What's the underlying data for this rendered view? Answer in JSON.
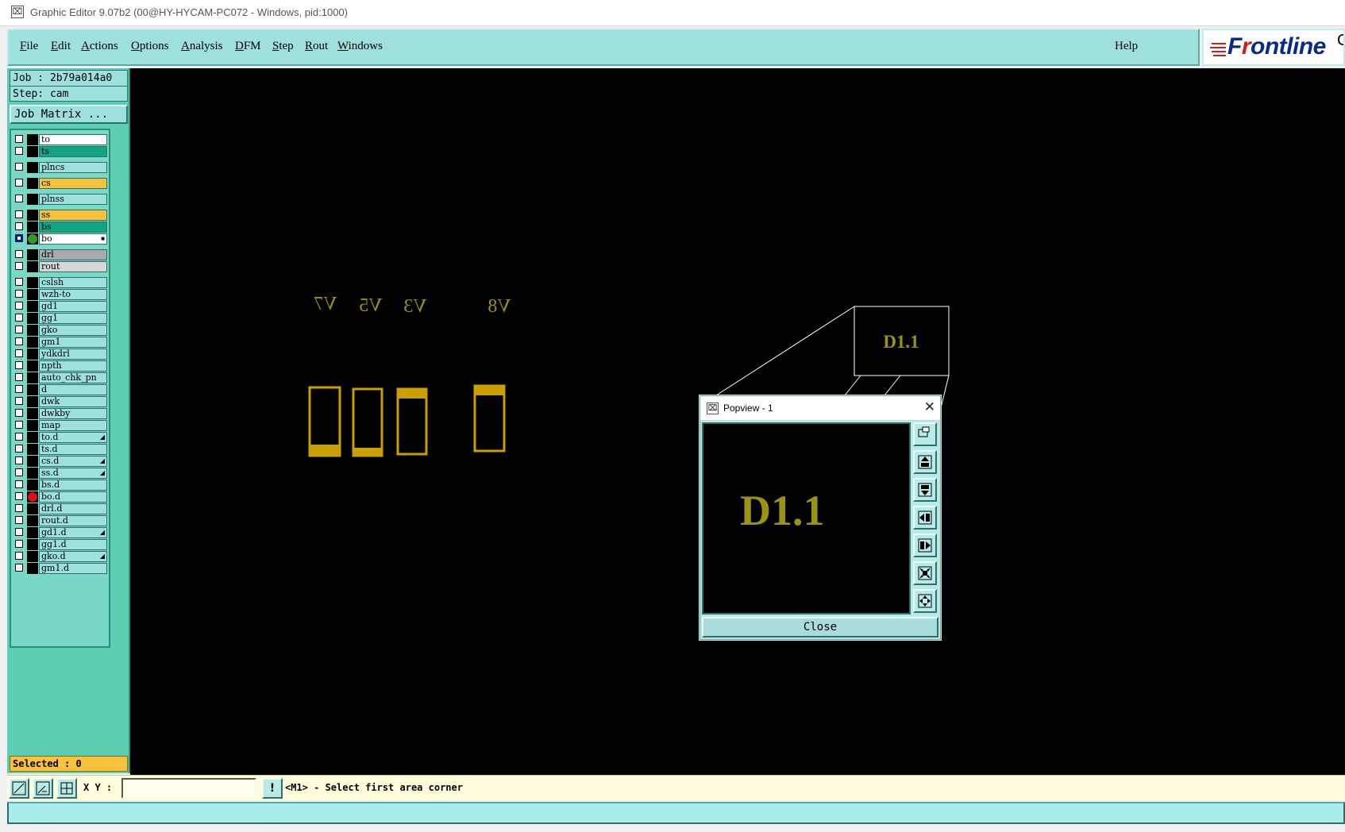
{
  "window": {
    "title": "Graphic Editor 9.07b2 (00@HY-HYCAM-PC072 - Windows, pid:1000)"
  },
  "menu": {
    "items": [
      {
        "u": "F",
        "rest": "ile"
      },
      {
        "u": "E",
        "rest": "dit"
      },
      {
        "u": "A",
        "rest": "ctions"
      },
      {
        "u": "O",
        "rest": "ptions"
      },
      {
        "u": "A",
        "rest": "nalysis"
      },
      {
        "u": "D",
        "rest": "FM"
      },
      {
        "u": "S",
        "rest": "tep"
      },
      {
        "u": "R",
        "rest": "out"
      },
      {
        "u": "W",
        "rest": "indows"
      }
    ],
    "help": "Help"
  },
  "logo": {
    "pre": "F",
    "red": "r",
    "post": "ontline",
    "edge": "C"
  },
  "job": {
    "job_line": "Job : 2b79a014a0",
    "step_line": "Step: cam",
    "matrix_button": "Job Matrix ..."
  },
  "layers": [
    {
      "name": "to",
      "color": "#ffffff"
    },
    {
      "name": "ts",
      "color": "#12a57f"
    },
    {
      "name": "plncs",
      "color": "#9ee0de"
    },
    {
      "name": "cs",
      "color": "#f9c23a"
    },
    {
      "name": "plnss",
      "color": "#9ee0de"
    },
    {
      "name": "ss",
      "color": "#f9c23a"
    },
    {
      "name": "bs",
      "color": "#12a57f"
    },
    {
      "name": "bo",
      "color": "#ffffff",
      "checked": true,
      "dot": "#2f9a2a",
      "mark": "■"
    },
    {
      "name": "drl",
      "color": "#a9a9a9"
    },
    {
      "name": "rout",
      "color": "#d7d7d7"
    },
    {
      "name": "cslsh",
      "color": "#9ee0de"
    },
    {
      "name": "wzh-to",
      "color": "#9ee0de"
    },
    {
      "name": "gd1",
      "color": "#9ee0de"
    },
    {
      "name": "gg1",
      "color": "#9ee0de"
    },
    {
      "name": "gko",
      "color": "#9ee0de"
    },
    {
      "name": "gm1",
      "color": "#9ee0de"
    },
    {
      "name": "ydkdrl",
      "color": "#9ee0de"
    },
    {
      "name": "npth",
      "color": "#9ee0de"
    },
    {
      "name": "auto_chk_pn",
      "color": "#9ee0de"
    },
    {
      "name": "d",
      "color": "#9ee0de"
    },
    {
      "name": "dwk",
      "color": "#9ee0de"
    },
    {
      "name": "dwkby",
      "color": "#9ee0de"
    },
    {
      "name": "map",
      "color": "#9ee0de"
    },
    {
      "name": "to.d",
      "color": "#9ee0de",
      "mark": "◢"
    },
    {
      "name": "ts.d",
      "color": "#9ee0de"
    },
    {
      "name": "cs.d",
      "color": "#9ee0de",
      "mark": "◢"
    },
    {
      "name": "ss.d",
      "color": "#9ee0de",
      "mark": "◢"
    },
    {
      "name": "bs.d",
      "color": "#9ee0de"
    },
    {
      "name": "bo.d",
      "color": "#9ee0de",
      "dot": "#e01010"
    },
    {
      "name": "drl.d",
      "color": "#9ee0de"
    },
    {
      "name": "rout.d",
      "color": "#9ee0de"
    },
    {
      "name": "gd1.d",
      "color": "#9ee0de",
      "mark": "◢"
    },
    {
      "name": "gg1.d",
      "color": "#9ee0de"
    },
    {
      "name": "gko.d",
      "color": "#9ee0de",
      "mark": "◢"
    },
    {
      "name": "gm1.d",
      "color": "#9ee0de"
    }
  ],
  "selected_text": "Selected : 0",
  "canvas": {
    "labels": [
      "V7",
      "V5",
      "V3",
      "V8"
    ],
    "zoom_label": "D1.1",
    "feature_color": "#c9a000",
    "text_color": "#9c9410"
  },
  "popview": {
    "title": "Popview - 1",
    "close_x": "✕",
    "label": "D1.1",
    "close_button": "Close",
    "tools": [
      "zoom-fit-icon",
      "pan-up-icon",
      "pan-down-icon",
      "pan-left-icon",
      "pan-right-icon",
      "zoom-in-icon",
      "zoom-out-icon"
    ]
  },
  "status": {
    "xy_label": "X Y :",
    "xy_value": "",
    "message": "<M1> - Select first area corner",
    "excl": "!"
  }
}
